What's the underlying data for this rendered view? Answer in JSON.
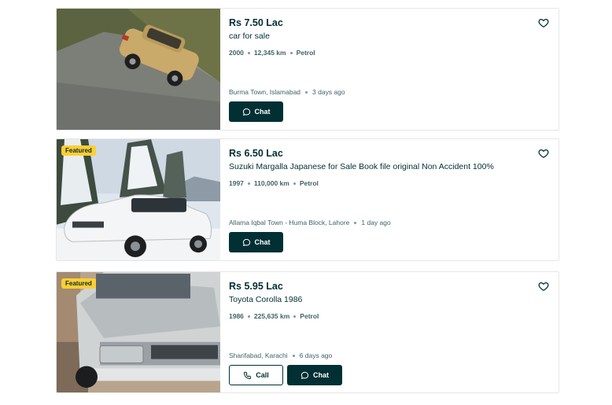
{
  "listings": [
    {
      "featured": false,
      "price": "Rs 7.50 Lac",
      "title": "car for sale",
      "year": "2000",
      "mileage": "12,345 km",
      "fuel": "Petrol",
      "location": "Burma Town, Islamabad",
      "posted": "3 days ago",
      "chat_label": "Chat"
    },
    {
      "featured": true,
      "featured_label": "Featured",
      "price": "Rs 6.50 Lac",
      "title": "Suzuki Margalla Japanese for Sale Book file original Non Accident 100%",
      "year": "1997",
      "mileage": "110,000 km",
      "fuel": "Petrol",
      "location": "Allama Iqbal Town - Huma Block, Lahore",
      "posted": "1 day ago",
      "chat_label": "Chat"
    },
    {
      "featured": true,
      "featured_label": "Featured",
      "price": "Rs 5.95 Lac",
      "title": "Toyota Corolla 1986",
      "year": "1986",
      "mileage": "225,635 km",
      "fuel": "Petrol",
      "location": "Sharifabad, Karachi",
      "posted": "6 days ago",
      "call_label": "Call",
      "chat_label": "Chat"
    }
  ],
  "icons": {
    "heart": "heart-icon",
    "chat": "chat-bubble-icon",
    "call": "phone-icon"
  },
  "colors": {
    "primary": "#002f34",
    "featured_badge": "#ffce32",
    "muted_text": "#406367"
  }
}
